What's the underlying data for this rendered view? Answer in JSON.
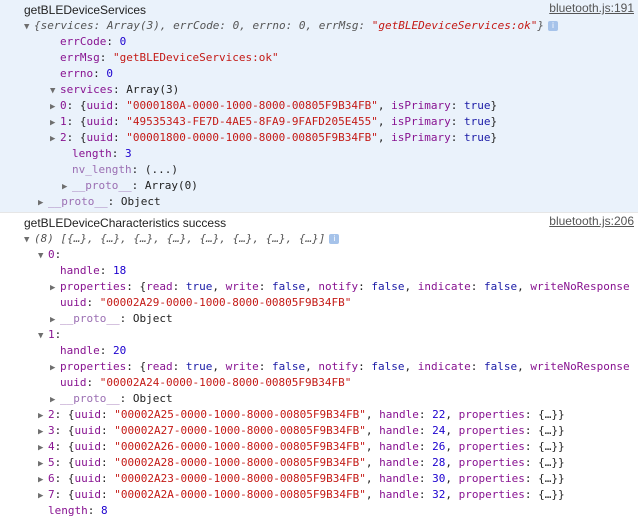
{
  "log1": {
    "message": "getBLEDeviceServices",
    "source": "bluetooth.js:191",
    "summary_prefix": "{services: Array(3), errCode: 0, errno: 0, errMsg: ",
    "summary_errMsg": "\"getBLEDeviceServices:ok\"",
    "summary_suffix": "}",
    "errCode_key": "errCode",
    "errCode_val": "0",
    "errMsg_key": "errMsg",
    "errMsg_val": "\"getBLEDeviceServices:ok\"",
    "errno_key": "errno",
    "errno_val": "0",
    "services_key": "services",
    "services_val": "Array(3)",
    "services": [
      {
        "idx": "0",
        "uuid": "\"0000180A-0000-1000-8000-00805F9B34FB\"",
        "primary": "true"
      },
      {
        "idx": "1",
        "uuid": "\"49535343-FE7D-4AE5-8FA9-9FAFD205E455\"",
        "primary": "true"
      },
      {
        "idx": "2",
        "uuid": "\"00001800-0000-1000-8000-00805F9B34FB\"",
        "primary": "true"
      }
    ],
    "length_key": "length",
    "length_val": "3",
    "nvlength_key": "nv_length",
    "nvlength_val": "(...)",
    "proto_arr_key": "__proto__",
    "proto_arr_val": "Array(0)",
    "proto_obj_key": "__proto__",
    "proto_obj_val": "Object"
  },
  "log2": {
    "message": "getBLEDeviceCharacteristics success",
    "source": "bluetooth.js:206",
    "summary": "(8) [{…}, {…}, {…}, {…}, {…}, {…}, {…}, {…}]",
    "expanded": [
      {
        "idx": "0",
        "handle": "18",
        "properties": "{read: true, write: false, notify: false, indicate: false, writeNoResponse",
        "uuid": "\"00002A29-0000-1000-8000-00805F9B34FB\"",
        "proto": "Object"
      },
      {
        "idx": "1",
        "handle": "20",
        "properties": "{read: true, write: false, notify: false, indicate: false, writeNoResponse",
        "uuid": "\"00002A24-0000-1000-8000-00805F9B34FB\"",
        "proto": "Object"
      }
    ],
    "collapsed": [
      {
        "idx": "2",
        "uuid": "\"00002A25-0000-1000-8000-00805F9B34FB\"",
        "handle": "22"
      },
      {
        "idx": "3",
        "uuid": "\"00002A27-0000-1000-8000-00805F9B34FB\"",
        "handle": "24"
      },
      {
        "idx": "4",
        "uuid": "\"00002A26-0000-1000-8000-00805F9B34FB\"",
        "handle": "26"
      },
      {
        "idx": "5",
        "uuid": "\"00002A28-0000-1000-8000-00805F9B34FB\"",
        "handle": "28"
      },
      {
        "idx": "6",
        "uuid": "\"00002A23-0000-1000-8000-00805F9B34FB\"",
        "handle": "30"
      },
      {
        "idx": "7",
        "uuid": "\"00002A2A-0000-1000-8000-00805F9B34FB\"",
        "handle": "32"
      }
    ],
    "length_key": "length",
    "length_val": "8"
  }
}
